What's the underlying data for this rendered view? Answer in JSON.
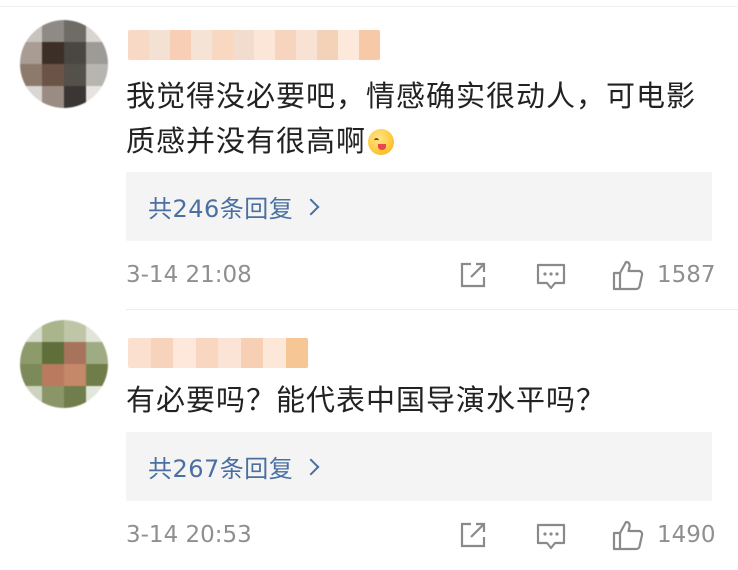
{
  "comments": [
    {
      "text_line1": "我觉得没必要吧，情感确实很动人，可电影",
      "text_line2": "质感并没有很高啊",
      "emoji": "drooling-face-emoji",
      "replies_label": "共246条回复",
      "timestamp": "3-14 21:08",
      "like_count": "1587"
    },
    {
      "text_line1": "有必要吗？能代表中国导演水平吗？",
      "replies_label": "共267条回复",
      "timestamp": "3-14 20:53",
      "like_count": "1490"
    }
  ],
  "icons": {
    "share": "share-icon",
    "comment": "comment-icon",
    "like": "thumbs-up-icon"
  },
  "colors": {
    "link": "#4a6fa0",
    "meta": "#8f8f8f",
    "text": "#222222",
    "reply_bg": "#f4f4f4"
  }
}
